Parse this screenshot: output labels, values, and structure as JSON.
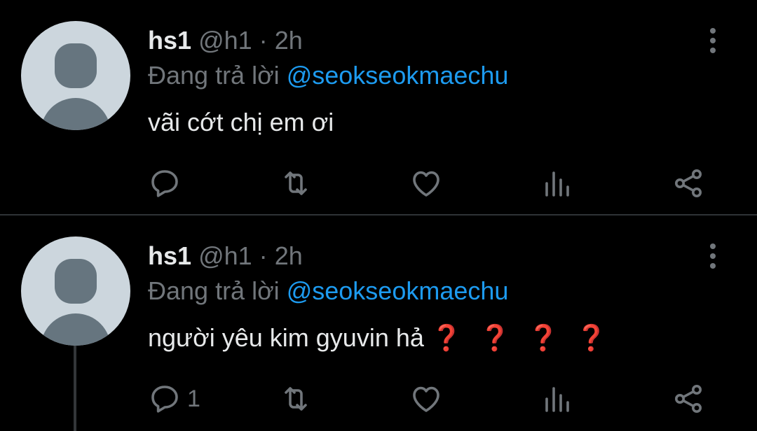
{
  "tweets": [
    {
      "name": "hs1",
      "handle": "@h1",
      "separator": "·",
      "time": "2h",
      "replying_prefix": "Đang trả lời",
      "replying_to": "@seokseokmaechu",
      "text": "vãi cớt chị em ơi",
      "reply_count": "",
      "emoji": []
    },
    {
      "name": "hs1",
      "handle": "@h1",
      "separator": "·",
      "time": "2h",
      "replying_prefix": "Đang trả lời",
      "replying_to": "@seokseokmaechu",
      "text": "người yêu kim gyuvin hả",
      "reply_count": "1",
      "emoji": [
        "❓",
        "❓",
        "❓",
        "❓"
      ]
    }
  ],
  "colors": {
    "background": "#000000",
    "primary_text": "#e7e9ea",
    "secondary_text": "#71767b",
    "accent": "#1d9bf0",
    "emoji_red": "#dd2e44"
  },
  "icons": [
    "reply-icon",
    "retweet-icon",
    "like-icon",
    "stats-icon",
    "share-icon",
    "more-options-icon"
  ]
}
